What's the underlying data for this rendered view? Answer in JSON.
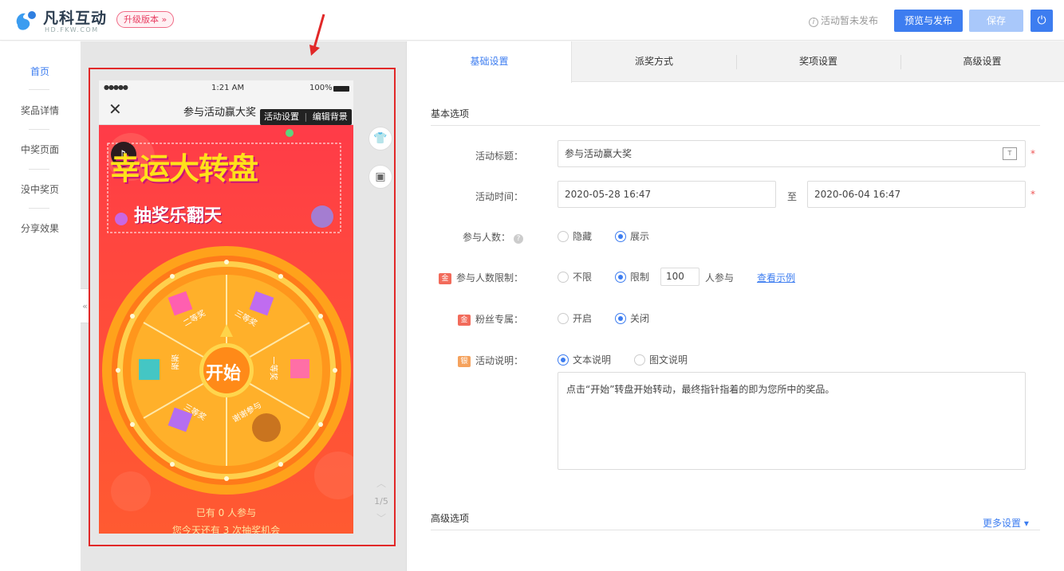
{
  "header": {
    "logo_text": "凡科互动",
    "logo_sub": "HD.FKW.COM",
    "upgrade_label": "升级版本 »",
    "status_icon": "info-icon",
    "publish_status": "活动暂未发布",
    "preview_publish_label": "预览与发布",
    "save_label": "保存",
    "power_icon": "power-icon"
  },
  "sidebar": {
    "items": [
      {
        "label": "首页",
        "active": true
      },
      {
        "label": "奖品详情"
      },
      {
        "label": "中奖页面"
      },
      {
        "label": "没中奖页"
      },
      {
        "label": "分享效果"
      }
    ]
  },
  "phone": {
    "signal": "●●●●●",
    "time": "1:21 AM",
    "battery": "100%",
    "page_title": "参与活动赢大奖",
    "tooltip_activity": "活动设置",
    "tooltip_bg": "编辑背景",
    "banner_title": "幸运大转盘",
    "banner_subtitle": "抽奖乐翻天",
    "start_label": "开始",
    "wheel_prizes": [
      "二等奖",
      "三等奖",
      "一等奖",
      "谢谢参与",
      "三等奖",
      "谢谢"
    ],
    "participants_text": "已有 0 人参与",
    "chances_text": "您今天还有 3 次抽奖机会",
    "pager": "1/5"
  },
  "tabs": [
    "基础设置",
    "派奖方式",
    "奖项设置",
    "高级设置"
  ],
  "form": {
    "basic_section": "基本选项",
    "title_label": "活动标题：",
    "title_value": "参与活动赢大奖",
    "time_label": "活动时间：",
    "time_start": "2020-05-28 16:47",
    "time_to": "至",
    "time_end": "2020-06-04 16:47",
    "participants_label": "参与人数：",
    "participants_hide": "隐藏",
    "participants_show": "展示",
    "limit_badge": "金",
    "limit_label": "参与人数限制：",
    "limit_none": "不限",
    "limit_yes": "限制",
    "limit_value": "100",
    "limit_suffix": "人参与",
    "limit_example": "查看示例",
    "fans_badge": "金",
    "fans_label": "粉丝专属：",
    "fans_on": "开启",
    "fans_off": "关闭",
    "desc_badge": "银",
    "desc_label": "活动说明：",
    "desc_text_option": "文本说明",
    "desc_image_option": "图文说明",
    "desc_content": "点击“开始”转盘开始转动，最终指针指着的即为您所中的奖品。",
    "advanced_section": "高级选项",
    "more_settings": "更多设置 ▾"
  },
  "colors": {
    "accent": "#3d7df0",
    "frame": "#e12828",
    "gold_badge": "#f26b5b",
    "silver_badge": "#f5a25d"
  }
}
